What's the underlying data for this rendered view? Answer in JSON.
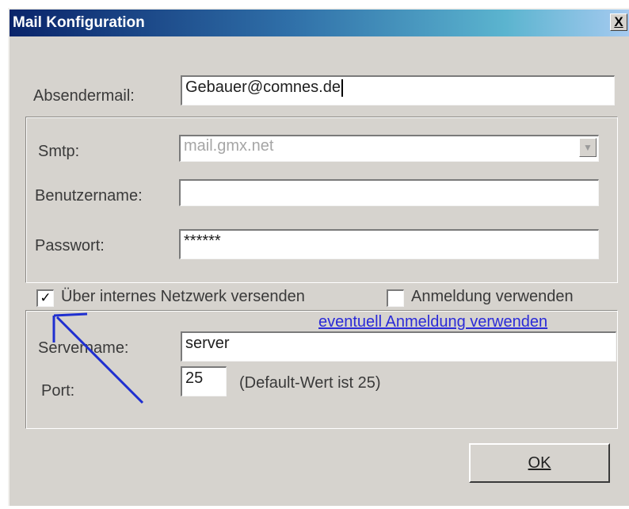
{
  "window": {
    "title": "Mail Konfiguration",
    "close_label": "X"
  },
  "sender": {
    "label": "Absendermail:",
    "value": "Gebauer@comnes.de"
  },
  "smtp": {
    "label": "Smtp:",
    "value": "mail.gmx.net",
    "dropdown_icon": "chevron-down-icon"
  },
  "username": {
    "label": "Benutzername:",
    "value": ""
  },
  "password": {
    "label": "Passwort:",
    "value": "******"
  },
  "options": {
    "internal_network": {
      "label": "Über internes Netzwerk versenden",
      "checked": true,
      "mark": "✓"
    },
    "use_login": {
      "label": "Anmeldung verwenden",
      "checked": false
    }
  },
  "annotation": {
    "text": "eventuell Anmeldung verwenden",
    "color": "#2a2ad8"
  },
  "server": {
    "servername_label": "Servername:",
    "servername_value": "server",
    "port_label": "Port:",
    "port_value": "25",
    "port_hint": "(Default-Wert ist 25)"
  },
  "buttons": {
    "ok_label": "OK"
  }
}
